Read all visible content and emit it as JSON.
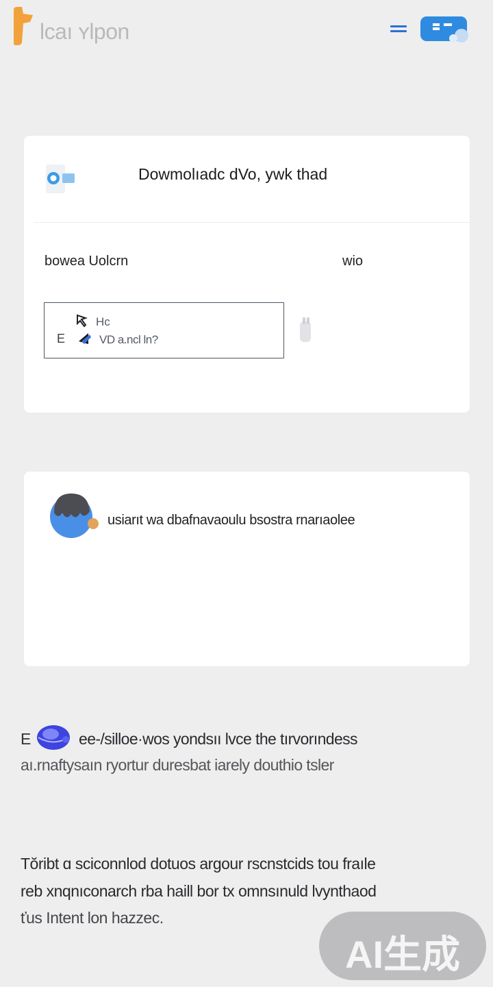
{
  "header": {
    "brand": "lcaı ʏlpon",
    "menu_icon": "hamburger-icon",
    "chat_icon": "chat-bubble-icon",
    "accent": "#2f8be0",
    "logo_color": "#f2a23a"
  },
  "download_card": {
    "icon": "download-icon",
    "title": "Dowmolıadc dVo, ywk thad",
    "left_label": "bowea Uolcrn",
    "right_label": "wio",
    "file": {
      "line1": "Hc",
      "line2": "VD a.ncl ln?",
      "glyph": "E"
    }
  },
  "notice_card": {
    "avatar": "avatar-icon",
    "text": "usiarıt wa dbafnavaoulu bsostra rnarıaolee"
  },
  "section_a": {
    "glyph": "E",
    "icon": "globe-icon",
    "line1": "ee-/silloe·wos yondsıı lvce the tırvorındess",
    "line2": "aı.rnaftysaın ryortur duresbat iarely douthio tsler"
  },
  "section_b": {
    "line1": "Tŏribt ɑ sciconnlod dotuos argour rscnstcids tou fraıle",
    "line2": "reb xnqnıconarch rba haill bor tx omnsınuld lvynthaod",
    "line3": "ťus Intent lon hazzec."
  },
  "watermark": {
    "text": "AI生成"
  }
}
